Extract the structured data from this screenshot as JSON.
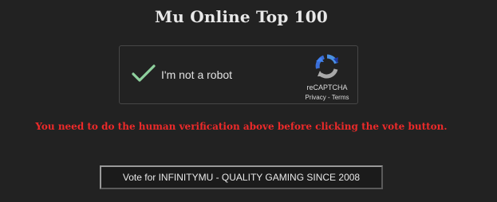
{
  "page": {
    "title": "Mu Online Top 100"
  },
  "captcha": {
    "label": "I'm not a robot",
    "brand": "reCAPTCHA",
    "privacy_label": "Privacy",
    "separator": " - ",
    "terms_label": "Terms",
    "checked": true,
    "check_color": "#8fd19e"
  },
  "warning": {
    "text": "You need to do the human verification above before clicking the vote button.",
    "color": "#ec2a2a"
  },
  "vote_button": {
    "label": "Vote for INFINITYMU - QUALITY GAMING SINCE 2008"
  }
}
